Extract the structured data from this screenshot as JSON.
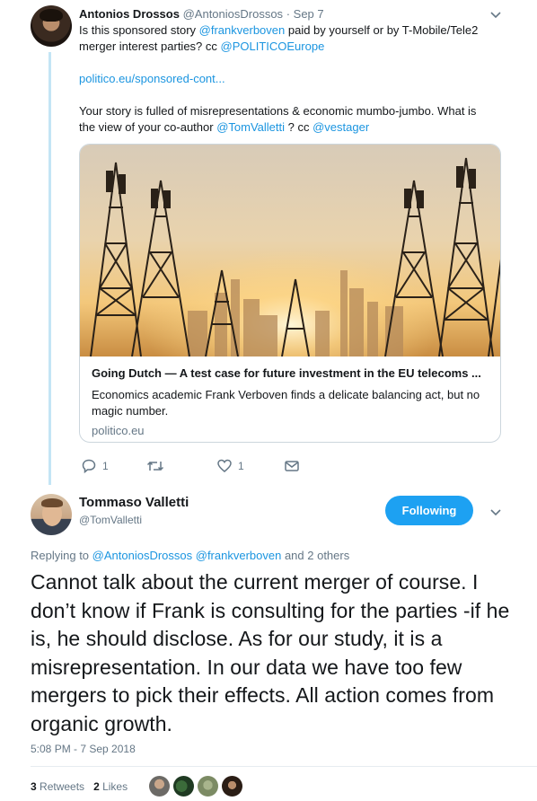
{
  "tweet1": {
    "name": "Antonios Drossos",
    "handle": "@AntoniosDrossos",
    "dot": "·",
    "date": "Sep 7",
    "line1_pre": "Is this sponsored story ",
    "line1_mention": "@frankverboven",
    "line1_post": " paid by yourself or by T-Mobile/Tele2",
    "line2_pre": "merger interest parties? cc ",
    "line2_mention": "@POLITICOEurope",
    "link": "politico.eu/sponsored-cont...",
    "line3": "Your story is fulled of misrepresentations & economic mumbo-jumbo. What is",
    "line4_pre": "the view of your co-author ",
    "line4_mention1": "@TomValletti",
    "line4_mid": " ? cc ",
    "line4_mention2": "@vestager",
    "card": {
      "title": "Going Dutch — A test case for future investment in the EU telecoms ...",
      "description": "Economics academic Frank Verboven finds a delicate balancing act, but no magic number.",
      "domain": "politico.eu"
    },
    "actions": {
      "reply_count": "1",
      "retweet_count": "",
      "like_count": "1"
    }
  },
  "tweet2": {
    "name": "Tommaso Valletti",
    "handle": "@TomValletti",
    "follow_label": "Following",
    "replying_prefix": "Replying to ",
    "replying_mention1": "@AntoniosDrossos",
    "replying_mention2": "@frankverboven",
    "replying_suffix": " and 2 others",
    "text": "Cannot talk about the current merger of course. I don’t know if Frank is consulting for the parties -if he is, he should disclose. As for our study, it is a misrepresentation. In our data we have too few mergers to pick their effects. All action comes from organic growth.",
    "timestamp": "5:08 PM - 7 Sep 2018",
    "retweets_count": "3",
    "retweets_label": "Retweets",
    "likes_count": "2",
    "likes_label": "Likes"
  },
  "colors": {
    "link": "#1b95e0",
    "follow_button": "#1da1f2",
    "thread_line": "#c4e5f5",
    "muted": "#657786"
  },
  "icons": [
    "chevron-down-icon",
    "reply-icon",
    "retweet-icon",
    "heart-icon",
    "direct-message-icon"
  ]
}
